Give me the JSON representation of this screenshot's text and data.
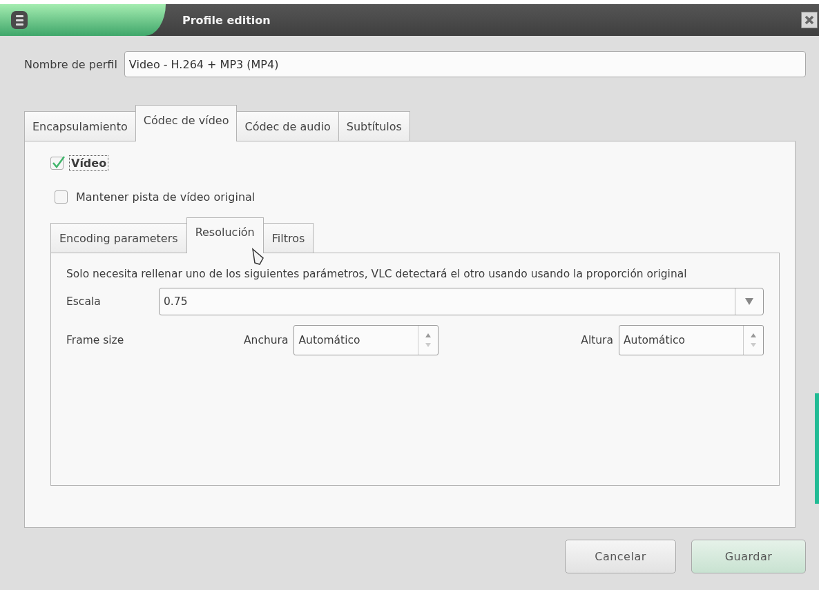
{
  "window": {
    "title": "Profile edition"
  },
  "profile_name": {
    "label": "Nombre de perfil",
    "value": "Video - H.264 + MP3 (MP4)"
  },
  "tabs": [
    {
      "label": "Encapsulamiento",
      "selected": false
    },
    {
      "label": "Códec de vídeo",
      "selected": true
    },
    {
      "label": "Códec de audio",
      "selected": false
    },
    {
      "label": "Subtítulos",
      "selected": false
    }
  ],
  "video_checkbox": {
    "label": "Vídeo",
    "checked": true
  },
  "keep_original_checkbox": {
    "label": "Mantener pista de vídeo original",
    "checked": false
  },
  "subtabs": [
    {
      "label": "Encoding parameters",
      "selected": false
    },
    {
      "label": "Resolución",
      "selected": true
    },
    {
      "label": "Filtros",
      "selected": false
    }
  ],
  "resolution": {
    "hint": "Solo necesita rellenar uno de los siguientes parámetros, VLC detectará el otro usando usando la proporción original",
    "scale_label": "Escala",
    "scale_value": "0.75",
    "frame_size_label": "Frame size",
    "width_label": "Anchura",
    "width_value": "Automático",
    "height_label": "Altura",
    "height_value": "Automático"
  },
  "buttons": [
    {
      "label": "Cancelar",
      "kind": "normal"
    },
    {
      "label": "Guardar",
      "kind": "default"
    }
  ]
}
